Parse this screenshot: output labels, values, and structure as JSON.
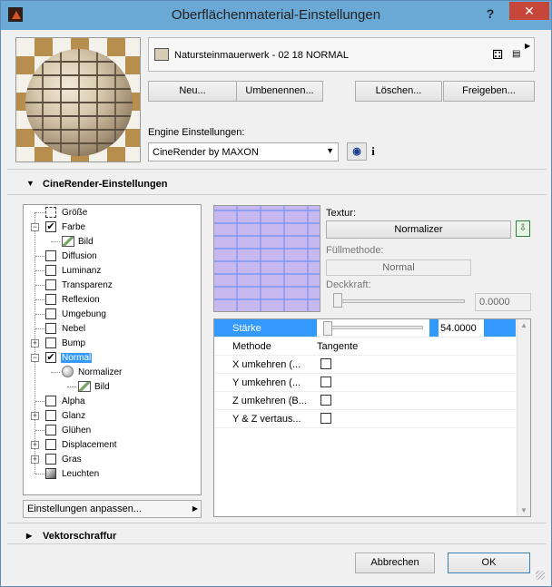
{
  "window": {
    "title": "Oberflächenmaterial-Einstellungen",
    "help_label": "?",
    "close_label": "✕"
  },
  "material": {
    "name": "Natursteinmauerwerk - 02 18 NORMAL",
    "swatch_color": "#d8cdb4",
    "icons": [
      "layers-icon",
      "document-icon"
    ]
  },
  "actions": {
    "new_label": "Neu...",
    "rename_label": "Umbenennen...",
    "delete_label": "Löschen...",
    "share_label": "Freigeben..."
  },
  "engine": {
    "label": "Engine Einstellungen:",
    "value": "CineRender by MAXON",
    "info_label": "i"
  },
  "sections": {
    "cinerender_title": "CineRender-Einstellungen",
    "vector_title": "Vektorschraffur"
  },
  "tree": {
    "items": [
      {
        "label": "Größe"
      },
      {
        "label": "Farbe",
        "checked": "✔"
      },
      {
        "label": "Bild"
      },
      {
        "label": "Diffusion"
      },
      {
        "label": "Luminanz"
      },
      {
        "label": "Transparenz"
      },
      {
        "label": "Reflexion"
      },
      {
        "label": "Umgebung"
      },
      {
        "label": "Nebel"
      },
      {
        "label": "Bump"
      },
      {
        "label": "Normal",
        "checked": "✔"
      },
      {
        "label": "Normalizer"
      },
      {
        "label": "Bild"
      },
      {
        "label": "Alpha"
      },
      {
        "label": "Glanz"
      },
      {
        "label": "Glühen"
      },
      {
        "label": "Displacement"
      },
      {
        "label": "Gras"
      },
      {
        "label": "Leuchten"
      }
    ],
    "expand_plus": "+",
    "expand_minus": "−",
    "settings_button": "Einstellungen anpassen..."
  },
  "texture": {
    "label": "Textur:",
    "button": "Normalizer",
    "fill_label": "Füllmethode:",
    "fill_value": "Normal",
    "opacity_label": "Deckkraft:",
    "opacity_value": "0.0000"
  },
  "params": {
    "strength_label": "Stärke",
    "strength_value": "54.0000",
    "method_label": "Methode",
    "method_value": "Tangente",
    "rows": [
      {
        "label": "X umkehren (..."
      },
      {
        "label": "Y umkehren (..."
      },
      {
        "label": "Z umkehren (B..."
      },
      {
        "label": "Y & Z vertaus..."
      }
    ]
  },
  "footer": {
    "cancel_label": "Abbrechen",
    "ok_label": "OK"
  },
  "colors": {
    "titlebar": "#6aa9d6",
    "close": "#c7463a",
    "selection": "#3399ff"
  }
}
